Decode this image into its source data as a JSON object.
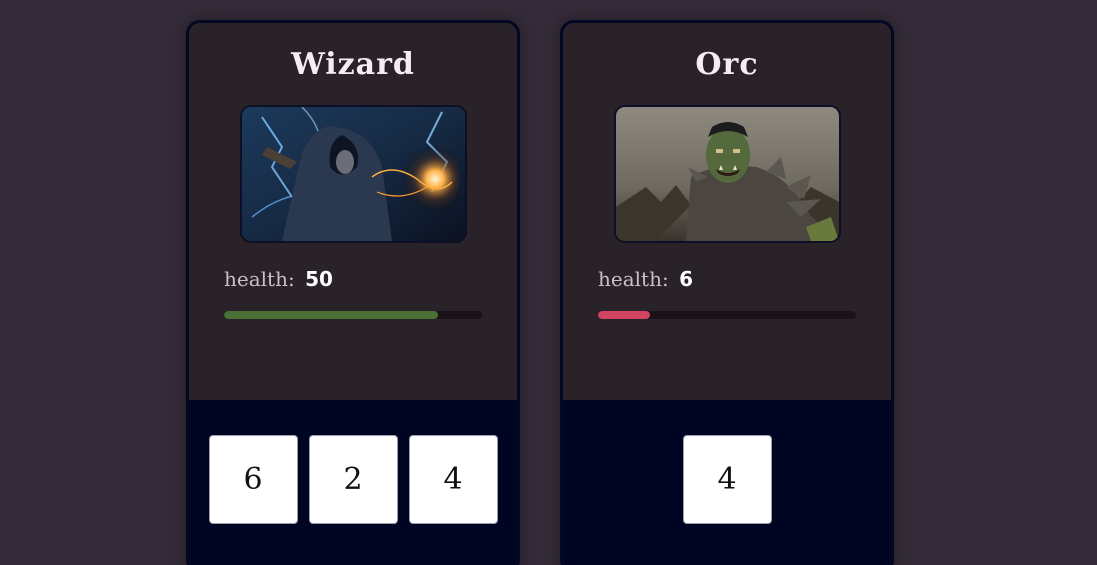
{
  "characters": [
    {
      "name": "Wizard",
      "health_label": "health:",
      "health_value": "50",
      "health_fraction": 0.83,
      "bar_color": "#4a7036",
      "dice": [
        "6",
        "2",
        "4"
      ],
      "portrait_icon": "wizard-portrait"
    },
    {
      "name": "Orc",
      "health_label": "health:",
      "health_value": "6",
      "health_fraction": 0.2,
      "bar_color": "#d1445f",
      "dice": [
        "4"
      ],
      "portrait_icon": "orc-portrait"
    }
  ],
  "colors": {
    "background": "#332b38",
    "card_top": "#2a2229",
    "card_bottom": "#000523",
    "card_border": "#020823"
  }
}
